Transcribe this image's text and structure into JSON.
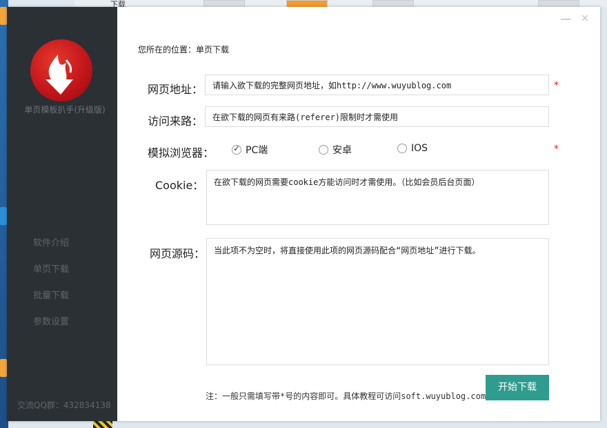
{
  "desktop": {
    "top_label": "下载"
  },
  "sidebar": {
    "app_name": "单页模板扒手(升级版)",
    "nav": [
      "软件介绍",
      "单页下载",
      "批量下载",
      "参数设置"
    ],
    "qq": "交流QQ群：432834138"
  },
  "breadcrumb": "您所在的位置：单页下载",
  "form": {
    "url_label": "网页地址：",
    "url_placeholder": "请输入欲下载的完整网页地址，如http://www.wuyublog.com",
    "referer_label": "访问来路：",
    "referer_placeholder": "在欲下载的网页有来路(referer)限制时才需使用",
    "browser_label": "模拟浏览器：",
    "browser_options": [
      "PC端",
      "安卓",
      "IOS"
    ],
    "browser_selected": "PC端",
    "cookie_label": "Cookie：",
    "cookie_placeholder": "在欲下载的网页需要cookie方能访问时才需使用。（比如会员后台页面）",
    "source_label": "网页源码：",
    "source_placeholder": "当此项不为空时，将直接使用此项的网页源码配合“网页地址”进行下载。",
    "required_mark": "*"
  },
  "note": "注：一般只需填写带*号的内容即可。具体教程可访问soft.wuyublog.com",
  "start_button": "开始下载",
  "colors": {
    "sidebar_bg": "#2a3033",
    "accent": "#2e9c8f",
    "required": "#e02020"
  }
}
